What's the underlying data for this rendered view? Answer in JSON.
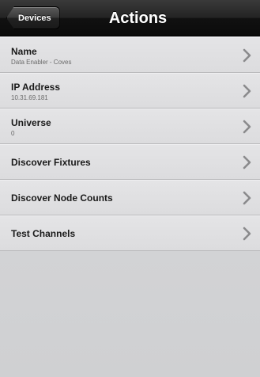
{
  "navbar": {
    "back_label": "Devices",
    "title": "Actions"
  },
  "rows": [
    {
      "label": "Name",
      "value": "Data Enabler - Coves",
      "icon": "chevron-right-icon"
    },
    {
      "label": "IP Address",
      "value": "10.31.69.181",
      "icon": "chevron-right-icon"
    },
    {
      "label": "Universe",
      "value": "0",
      "icon": "chevron-right-icon"
    },
    {
      "label": "Discover Fixtures",
      "icon": "chevron-right-icon"
    },
    {
      "label": "Discover Node Counts",
      "icon": "chevron-right-icon"
    },
    {
      "label": "Test Channels",
      "icon": "chevron-right-icon"
    }
  ],
  "colors": {
    "navbar": "#1a1a1a",
    "row_background": "#e0e0e2",
    "screen_background": "#d4d4d6",
    "chevron": "#8a8a8c"
  }
}
